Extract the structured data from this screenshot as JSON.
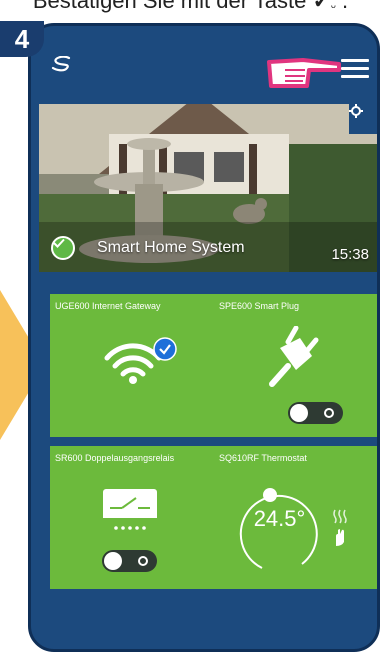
{
  "caption": {
    "text": "Bestätigen Sie mit der Taste",
    "end": "."
  },
  "step": {
    "number": "4"
  },
  "app": {
    "title": "Smart Home System",
    "time": "15:38"
  },
  "tiles": [
    {
      "title": "UGE600 Internet Gateway"
    },
    {
      "title": "SPE600 Smart Plug"
    },
    {
      "title": "SR600 Doppelausgangsrelais"
    },
    {
      "title": "SQ610RF Thermostat",
      "value": "24.5°"
    }
  ],
  "colors": {
    "phone_bg": "#1c4a7e",
    "tile_green": "#6cba3c",
    "accent_pink": "#e0357f",
    "check_blue": "#1e6fd9"
  },
  "icons": [
    "logo-icon",
    "pointing-hand-icon",
    "menu-icon",
    "gear-icon",
    "check-icon",
    "wifi-icon",
    "plug-icon",
    "relay-icon",
    "heat-icon",
    "hand-icon"
  ]
}
